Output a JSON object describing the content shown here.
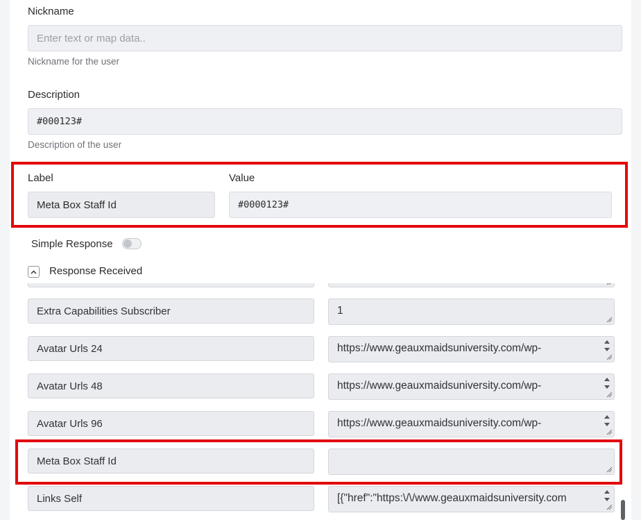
{
  "nickname": {
    "label": "Nickname",
    "placeholder": "Enter text or map data..",
    "help": "Nickname for the user"
  },
  "description": {
    "label": "Description",
    "value": "#000123#",
    "help": "Description of the user"
  },
  "meta": {
    "label_header": "Label",
    "value_header": "Value",
    "label_value": "Meta Box Staff Id",
    "value_value": "#0000123#"
  },
  "simple_response": {
    "label": "Simple Response",
    "enabled": false
  },
  "response_received": {
    "label": "Response Received",
    "expanded": true,
    "rows": [
      {
        "label": "",
        "value": ""
      },
      {
        "label": "Extra Capabilities Subscriber",
        "value": "1"
      },
      {
        "label": "Avatar Urls 24",
        "value": "https://www.geauxmaidsuniversity.com/wp-"
      },
      {
        "label": "Avatar Urls 48",
        "value": "https://www.geauxmaidsuniversity.com/wp-"
      },
      {
        "label": "Avatar Urls 96",
        "value": "https://www.geauxmaidsuniversity.com/wp-"
      },
      {
        "label": "Meta Box Staff Id",
        "value": ""
      },
      {
        "label": " Links Self",
        "value": "[{\"href\":\"https:\\/\\/www.geauxmaidsuniversity.com"
      }
    ]
  },
  "colors": {
    "highlight": "#e2070b",
    "field_bg": "#eef0f3",
    "help_text": "#6f7278"
  },
  "icons": [
    "chevron-up-icon",
    "resize-handle-icon",
    "spinner-arrows-icon",
    "toggle-switch"
  ]
}
